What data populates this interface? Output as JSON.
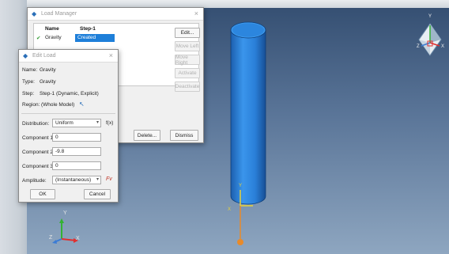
{
  "load_manager": {
    "title": "Load Manager",
    "close_glyph": "×",
    "columns": {
      "name": "Name",
      "step": "Step-1"
    },
    "rows": [
      {
        "check": "✔",
        "name": "Gravity",
        "status": "Created"
      }
    ],
    "buttons": {
      "edit": "Edit...",
      "move_left": "Move Left",
      "move_right": "Move Right",
      "activate": "Activate",
      "deactivate": "Deactivate",
      "delete": "Delete...",
      "dismiss": "Dismiss"
    }
  },
  "edit_load": {
    "title": "Edit Load",
    "close_glyph": "×",
    "name_label": "Name:",
    "name_value": "Gravity",
    "type_label": "Type:",
    "type_value": "Gravity",
    "step_label": "Step:",
    "step_value": "Step-1 (Dynamic, Explicit)",
    "region_label": "Region:",
    "region_value": "(Whole Model)",
    "distribution_label": "Distribution:",
    "distribution_value": "Uniform",
    "fx_label": "f(x)",
    "component1_label": "Component 1:",
    "component1_value": "0",
    "component2_label": "Component 2:",
    "component2_value": "-9.8",
    "component3_label": "Component 3:",
    "component3_value": "0",
    "amplitude_label": "Amplitude:",
    "amplitude_value": "(Instantaneous)",
    "amp_icon_glyph": "Fv",
    "ok": "OK",
    "cancel": "Cancel"
  },
  "viewport": {
    "triad_labels": {
      "y": "Y",
      "x": "X",
      "z": "Z"
    },
    "part_triad_labels": {
      "y": "Y",
      "x": "X"
    },
    "view_cube_labels": {
      "y": "Y",
      "x": "X",
      "z": "Z"
    }
  },
  "colors": {
    "cylinder": "#2f86e0",
    "selection": "#1e7fd9",
    "axis_x": "#e03030",
    "axis_y": "#33b233",
    "axis_z": "#3a7bd5"
  }
}
